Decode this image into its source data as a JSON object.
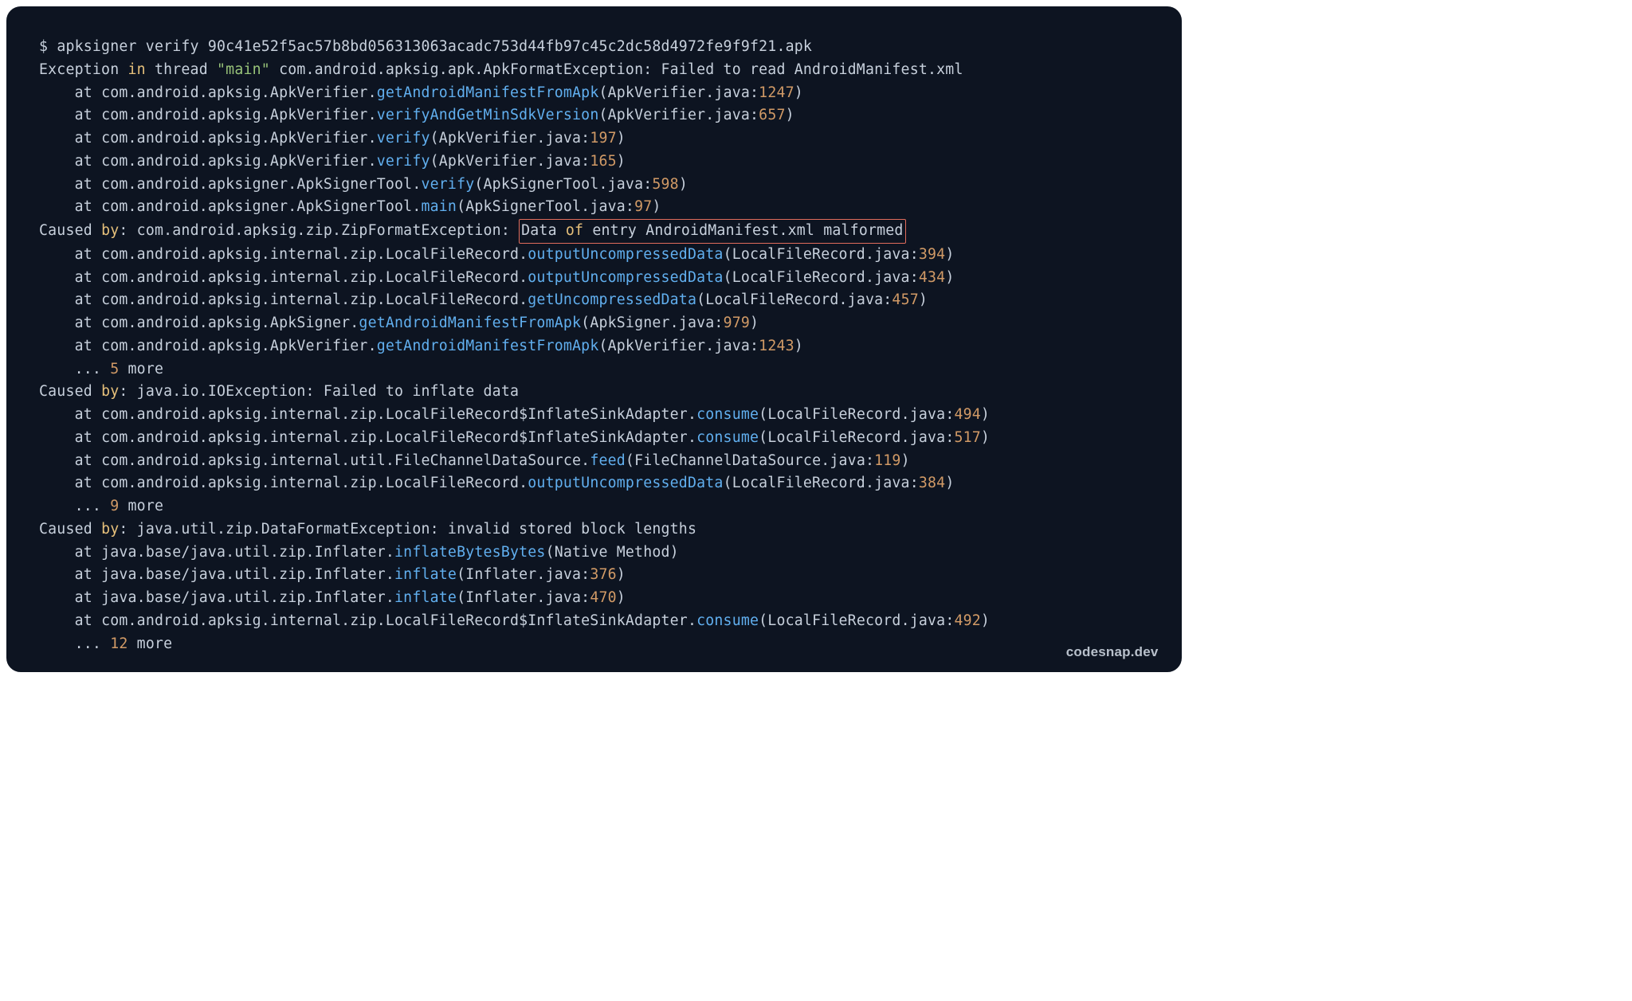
{
  "cmd": {
    "prompt": "$ ",
    "command": "apksigner verify 90c41e52f5ac57b8bd056313063acadc753d44fb97c45c2dc58d4972fe9f9f21.apk"
  },
  "exc": {
    "prefix": "Exception ",
    "in": "in",
    "thread_lbl": " thread ",
    "thread_name": "\"main\"",
    "rest": " com.android.apksig.apk.ApkFormatException: Failed to read AndroidManifest.xml"
  },
  "st1": [
    {
      "at": "at",
      "pkg": " com.android.apksig.ApkVerifier.",
      "method": "getAndroidManifestFromApk",
      "paren_open": "(ApkVerifier.java:",
      "line": "1247",
      "paren_close": ")"
    },
    {
      "at": "at",
      "pkg": " com.android.apksig.ApkVerifier.",
      "method": "verifyAndGetMinSdkVersion",
      "paren_open": "(ApkVerifier.java:",
      "line": "657",
      "paren_close": ")"
    },
    {
      "at": "at",
      "pkg": " com.android.apksig.ApkVerifier.",
      "method": "verify",
      "paren_open": "(ApkVerifier.java:",
      "line": "197",
      "paren_close": ")"
    },
    {
      "at": "at",
      "pkg": " com.android.apksig.ApkVerifier.",
      "method": "verify",
      "paren_open": "(ApkVerifier.java:",
      "line": "165",
      "paren_close": ")"
    },
    {
      "at": "at",
      "pkg": " com.android.apksigner.ApkSignerTool.",
      "method": "verify",
      "paren_open": "(ApkSignerTool.java:",
      "line": "598",
      "paren_close": ")"
    },
    {
      "at": "at",
      "pkg": " com.android.apksigner.ApkSignerTool.",
      "method": "main",
      "paren_open": "(ApkSignerTool.java:",
      "line": "97",
      "paren_close": ")"
    }
  ],
  "cause1": {
    "caused": "Caused ",
    "by": "by",
    "rest": ": com.android.apksig.zip.ZipFormatException: ",
    "hl_data": "Data ",
    "hl_of": "of",
    "hl_rest": " entry AndroidManifest.xml malformed"
  },
  "st2": [
    {
      "at": "at",
      "pkg": " com.android.apksig.internal.zip.LocalFileRecord.",
      "method": "outputUncompressedData",
      "paren_open": "(LocalFileRecord.java:",
      "line": "394",
      "paren_close": ")"
    },
    {
      "at": "at",
      "pkg": " com.android.apksig.internal.zip.LocalFileRecord.",
      "method": "outputUncompressedData",
      "paren_open": "(LocalFileRecord.java:",
      "line": "434",
      "paren_close": ")"
    },
    {
      "at": "at",
      "pkg": " com.android.apksig.internal.zip.LocalFileRecord.",
      "method": "getUncompressedData",
      "paren_open": "(LocalFileRecord.java:",
      "line": "457",
      "paren_close": ")"
    },
    {
      "at": "at",
      "pkg": " com.android.apksig.ApkSigner.",
      "method": "getAndroidManifestFromApk",
      "paren_open": "(ApkSigner.java:",
      "line": "979",
      "paren_close": ")"
    },
    {
      "at": "at",
      "pkg": " com.android.apksig.ApkVerifier.",
      "method": "getAndroidManifestFromApk",
      "paren_open": "(ApkVerifier.java:",
      "line": "1243",
      "paren_close": ")"
    }
  ],
  "more1": {
    "dots": "... ",
    "n": "5",
    "more": " more"
  },
  "cause2": {
    "caused": "Caused ",
    "by": "by",
    "rest": ": java.io.IOException: Failed to inflate data"
  },
  "st3": [
    {
      "at": "at",
      "pkg": " com.android.apksig.internal.zip.LocalFileRecord$InflateSinkAdapter.",
      "method": "consume",
      "paren_open": "(LocalFileRecord.java:",
      "line": "494",
      "paren_close": ")"
    },
    {
      "at": "at",
      "pkg": " com.android.apksig.internal.zip.LocalFileRecord$InflateSinkAdapter.",
      "method": "consume",
      "paren_open": "(LocalFileRecord.java:",
      "line": "517",
      "paren_close": ")"
    },
    {
      "at": "at",
      "pkg": " com.android.apksig.internal.util.FileChannelDataSource.",
      "method": "feed",
      "paren_open": "(FileChannelDataSource.java:",
      "line": "119",
      "paren_close": ")"
    },
    {
      "at": "at",
      "pkg": " com.android.apksig.internal.zip.LocalFileRecord.",
      "method": "outputUncompressedData",
      "paren_open": "(LocalFileRecord.java:",
      "line": "384",
      "paren_close": ")"
    }
  ],
  "more2": {
    "dots": "... ",
    "n": "9",
    "more": " more"
  },
  "cause3": {
    "caused": "Caused ",
    "by": "by",
    "rest": ": java.util.zip.DataFormatException: invalid stored block lengths"
  },
  "st4": [
    {
      "at": "at",
      "pkg": " java.base/java.util.zip.Inflater.",
      "method": "inflateBytesBytes",
      "paren_open": "(Native Method)",
      "line": "",
      "paren_close": ""
    },
    {
      "at": "at",
      "pkg": " java.base/java.util.zip.Inflater.",
      "method": "inflate",
      "paren_open": "(Inflater.java:",
      "line": "376",
      "paren_close": ")"
    },
    {
      "at": "at",
      "pkg": " java.base/java.util.zip.Inflater.",
      "method": "inflate",
      "paren_open": "(Inflater.java:",
      "line": "470",
      "paren_close": ")"
    },
    {
      "at": "at",
      "pkg": " com.android.apksig.internal.zip.LocalFileRecord$InflateSinkAdapter.",
      "method": "consume",
      "paren_open": "(LocalFileRecord.java:",
      "line": "492",
      "paren_close": ")"
    }
  ],
  "more3": {
    "dots": "... ",
    "n": "12",
    "more": " more"
  },
  "watermark": "codesnap.dev"
}
